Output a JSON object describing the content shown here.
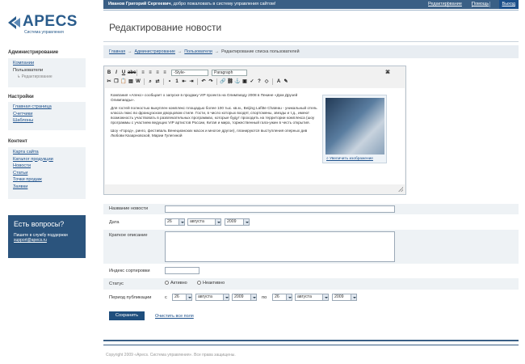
{
  "topbar": {
    "greeting_name": "Иванов Григорий Сергеевич",
    "greeting_rest": ", добро пожаловать в систему управления сайтом!",
    "links": [
      "Редактирование",
      "Помощь"
    ],
    "exit": "Выход"
  },
  "logo": {
    "text": "APECS",
    "subtitle": "Система управления"
  },
  "sidebar": {
    "admin": {
      "title": "Администрирование",
      "items": [
        "Компании",
        "Пользователи"
      ],
      "subitem": "Редактирование"
    },
    "settings": {
      "title": "Настройки",
      "items": [
        "Главная страница",
        "Счетчики",
        "Шаблоны"
      ]
    },
    "content": {
      "title": "Контент",
      "items": [
        "Карта сайта",
        "Каталог продукции",
        "Новости",
        "Статьи",
        "Точки продаж",
        "Заявки"
      ]
    },
    "help": {
      "title": "Есть вопросы?",
      "text": "Пишите в службу поддержки",
      "email": "support@apecs.ru"
    }
  },
  "page": {
    "title": "Редактирование новости"
  },
  "breadcrumb": {
    "items": [
      "Главная",
      "Администрирование",
      "Пользователи"
    ],
    "current": "Редактирование списка пользователей"
  },
  "editor": {
    "style_select": "-Style-",
    "format_select": "Paragraph",
    "paragraphs": [
      "Компания «Апекс» сообщает о запуске в продажу VIP проекта на Олимпиаду 2008 в Пекине «Дом Друзей Олимпиады».",
      "Для гостей полностью выкуплен комплекс площадью более 100 тыс. кв.м., Beijing Lafitte Chateau - уникальный отель класса люкс во французском дворцовом стиле. Гости, в число которых входят, спортсмены, звезды и т.д., имеют возможность участвовать в развлекательных программах, которые будут проходить на территории комплекса (шоу программы с участием ведущих VIP артистов России, Китая и мира, торжественный гала-ужин в честь открытия.",
      "Шоу «Город», ринго, фестиваль Венецианских масок и многое другое), планируются выступления оперных див Любови Казарновской, Марии Гулегиной"
    ],
    "image_caption": "Увеличить изображение"
  },
  "form": {
    "title_label": "Название новости",
    "date_label": "Дата",
    "date": {
      "day": "26",
      "month": "августа",
      "year": "2009"
    },
    "desc_label": "Краткое описание",
    "sort_label": "Индекс сортировки",
    "status_label": "Статус",
    "status_active": "Активно",
    "status_inactive": "Неактивно",
    "period_label": "Период публикации",
    "from_word": "с",
    "to_word": "по",
    "period_from": {
      "day": "26",
      "month": "августа",
      "year": "2009"
    },
    "period_to": {
      "day": "26",
      "month": "августа",
      "year": "2009"
    },
    "save_button": "Сохранить",
    "clear_link": "Очистить все поля"
  },
  "footer": {
    "copyright": "Copyright 2009 «Apecs. Система управления». Все права защищены."
  },
  "colors": {
    "accent": "#3a5f85",
    "link": "#1b4f8a"
  }
}
